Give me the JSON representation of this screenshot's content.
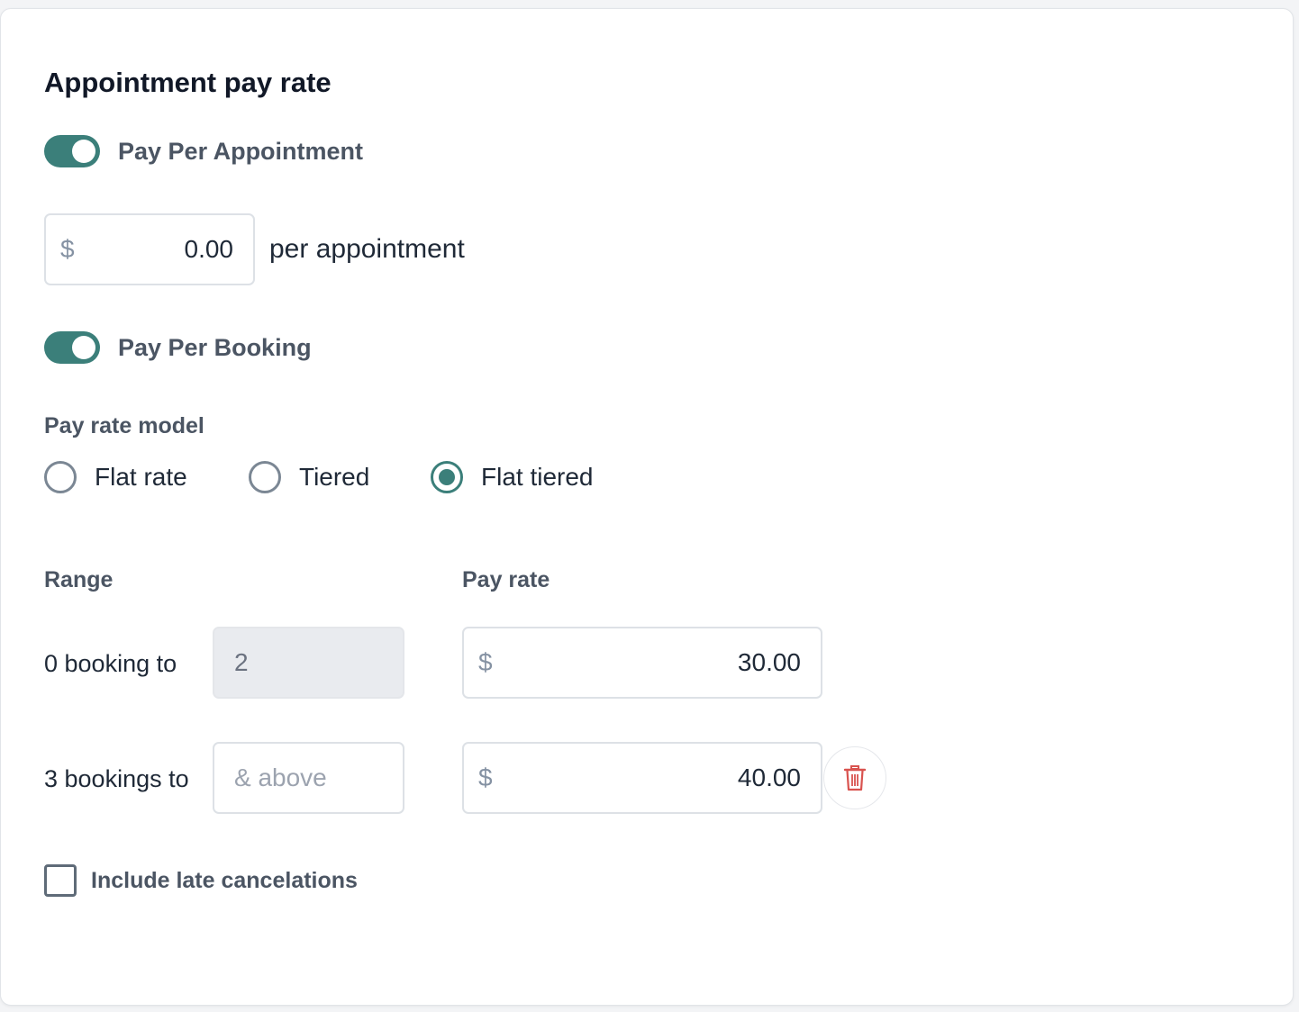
{
  "section": {
    "title": "Appointment pay rate"
  },
  "pay_per_appointment": {
    "label": "Pay Per Appointment",
    "enabled": true,
    "currency_prefix": "$",
    "amount": "0.00",
    "suffix": "per appointment"
  },
  "pay_per_booking": {
    "label": "Pay Per Booking",
    "enabled": true
  },
  "pay_rate_model": {
    "label": "Pay rate model",
    "options": [
      {
        "label": "Flat rate",
        "selected": false
      },
      {
        "label": "Tiered",
        "selected": false
      },
      {
        "label": "Flat tiered",
        "selected": true
      }
    ]
  },
  "tiers": {
    "range_header": "Range",
    "pay_rate_header": "Pay rate",
    "currency_prefix": "$",
    "rows": [
      {
        "label": "0 booking to",
        "range_value": "2",
        "range_placeholder": "",
        "pay_rate": "30.00"
      },
      {
        "label": "3 bookings to",
        "range_value": "",
        "range_placeholder": "& above",
        "pay_rate": "40.00"
      }
    ]
  },
  "late_cancelations": {
    "label": "Include late cancelations",
    "checked": false
  },
  "colors": {
    "accent": "#3b7f7a",
    "delete": "#d9534f"
  },
  "icons": {
    "delete": "trash-icon"
  }
}
